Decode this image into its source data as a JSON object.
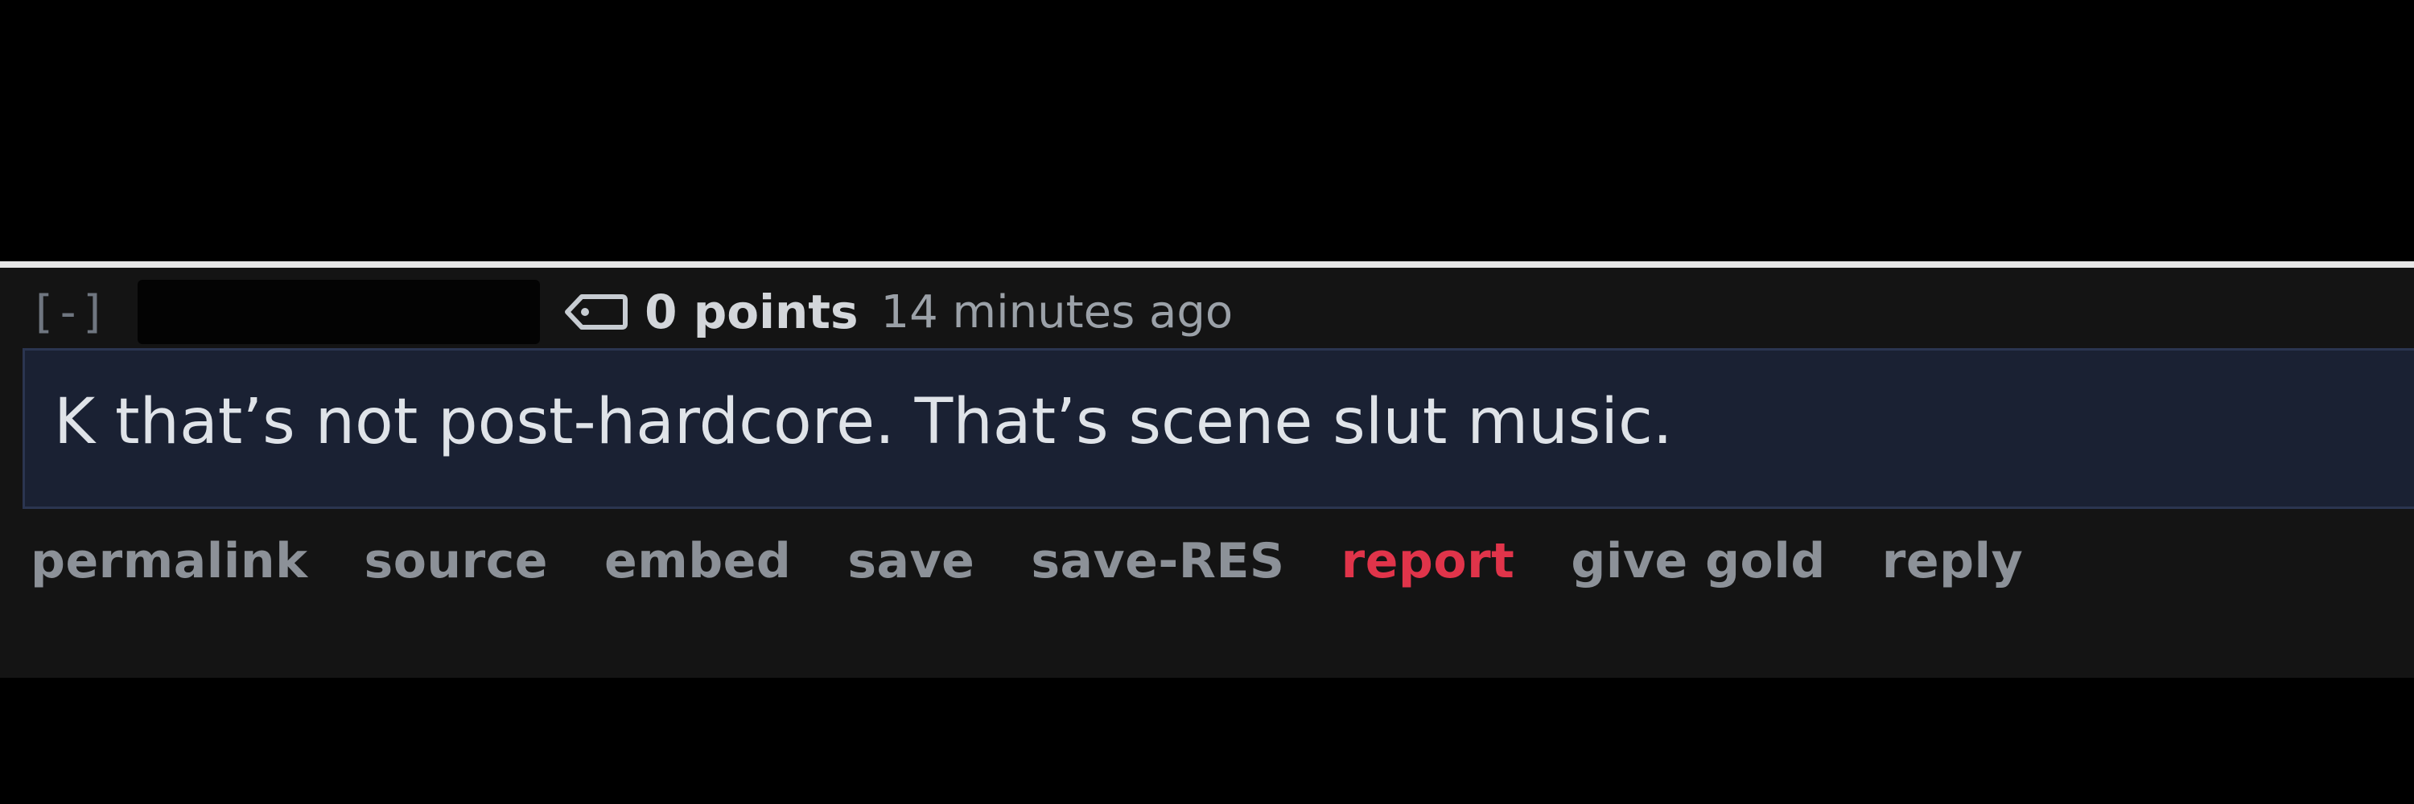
{
  "comment": {
    "collapse_label": "[-]",
    "score": "0 points",
    "time": "14 minutes ago",
    "body": "K that’s not post-hardcore. That’s scene slut music.",
    "flair_icon": "tag-icon"
  },
  "actions": [
    {
      "label": "permalink"
    },
    {
      "label": "source"
    },
    {
      "label": "embed"
    },
    {
      "label": "save"
    },
    {
      "label": "save-RES"
    },
    {
      "label": "report"
    },
    {
      "label": "give gold"
    },
    {
      "label": "reply"
    }
  ],
  "colors": {
    "page_background": "#000000",
    "comment_background": "#141414",
    "body_background": "#1a2133",
    "report_color": "#e0344a",
    "action_color": "#8c9198"
  }
}
